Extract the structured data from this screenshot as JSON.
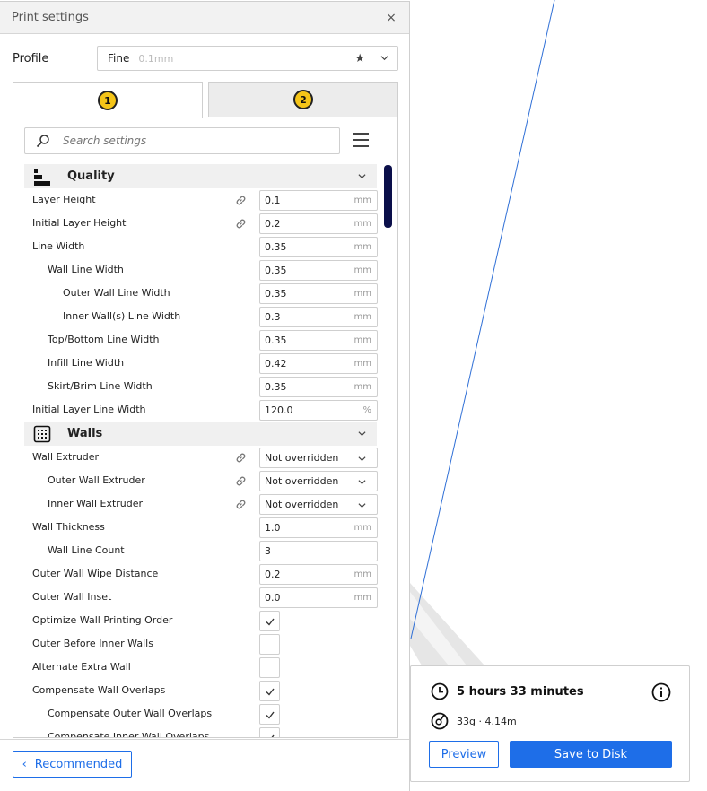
{
  "panel": {
    "title": "Print settings",
    "close_glyph": "×"
  },
  "profile": {
    "label": "Profile",
    "value": "Fine",
    "layer_hint": "0.1mm",
    "star_glyph": "★"
  },
  "tabs": [
    {
      "label": "1",
      "active": true
    },
    {
      "label": "2",
      "active": false
    }
  ],
  "search": {
    "placeholder": "Search settings"
  },
  "categories": {
    "quality": {
      "label": "Quality",
      "icon": "quality-layers-icon",
      "rows": [
        {
          "label": "Layer Height",
          "value": "0.1",
          "unit": "mm",
          "linked": true
        },
        {
          "label": "Initial Layer Height",
          "value": "0.2",
          "unit": "mm",
          "linked": true
        },
        {
          "label": "Line Width",
          "value": "0.35",
          "unit": "mm"
        },
        {
          "label": "Wall Line Width",
          "value": "0.35",
          "unit": "mm"
        },
        {
          "label": "Outer Wall Line Width",
          "value": "0.35",
          "unit": "mm"
        },
        {
          "label": "Inner Wall(s) Line Width",
          "value": "0.3",
          "unit": "mm"
        },
        {
          "label": "Top/Bottom Line Width",
          "value": "0.35",
          "unit": "mm"
        },
        {
          "label": "Infill Line Width",
          "value": "0.42",
          "unit": "mm"
        },
        {
          "label": "Skirt/Brim Line Width",
          "value": "0.35",
          "unit": "mm"
        },
        {
          "label": "Initial Layer Line Width",
          "value": "120.0",
          "unit": "%"
        }
      ]
    },
    "walls": {
      "label": "Walls",
      "icon": "walls-grid-icon",
      "rows": [
        {
          "label": "Wall Extruder",
          "value": "Not overridden",
          "linked": true
        },
        {
          "label": "Outer Wall Extruder",
          "value": "Not overridden",
          "linked": true
        },
        {
          "label": "Inner Wall Extruder",
          "value": "Not overridden",
          "linked": true
        },
        {
          "label": "Wall Thickness",
          "value": "1.0",
          "unit": "mm"
        },
        {
          "label": "Wall Line Count",
          "value": "3"
        },
        {
          "label": "Outer Wall Wipe Distance",
          "value": "0.2",
          "unit": "mm"
        },
        {
          "label": "Outer Wall Inset",
          "value": "0.0",
          "unit": "mm"
        },
        {
          "label": "Optimize Wall Printing Order",
          "checked": true
        },
        {
          "label": "Outer Before Inner Walls",
          "checked": false
        },
        {
          "label": "Alternate Extra Wall",
          "checked": false
        },
        {
          "label": "Compensate Wall Overlaps",
          "checked": true
        },
        {
          "label": "Compensate Outer Wall Overlaps",
          "checked": true
        },
        {
          "label": "Compensate Inner Wall Overlaps",
          "checked": true
        }
      ]
    }
  },
  "footer": {
    "recommended_label": "Recommended",
    "recommended_glyph": "‹"
  },
  "action": {
    "time": "5 hours 33 minutes",
    "material": "33g · 4.14m",
    "preview_label": "Preview",
    "save_label": "Save to Disk"
  },
  "colors": {
    "accent": "#1e6ee8",
    "extruder_yellow": "#f5c518",
    "scrollbar": "#0b0f4a"
  }
}
